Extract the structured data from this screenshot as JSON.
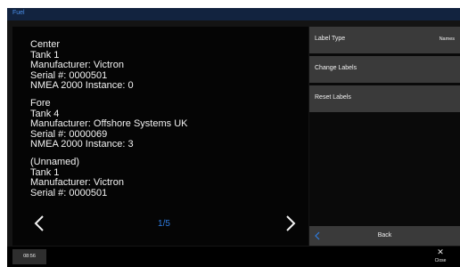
{
  "window": {
    "title": "Fuel"
  },
  "tanks": [
    {
      "name": "Center",
      "tank": "Tank 1",
      "manufacturer": "Manufacturer: Victron",
      "serial": "Serial #: 0000501",
      "instance": "NMEA 2000 Instance: 0"
    },
    {
      "name": "Fore",
      "tank": "Tank 4",
      "manufacturer": "Manufacturer: Offshore Systems UK",
      "serial": "Serial #: 0000069",
      "instance": "NMEA 2000 Instance: 3"
    },
    {
      "name": "(Unnamed)",
      "tank": "Tank 1",
      "manufacturer": "Manufacturer: Victron",
      "serial": "Serial #: 0000501"
    }
  ],
  "pager": {
    "indicator": "1/5",
    "prev_icon": "chevron-left-icon",
    "next_icon": "chevron-right-icon"
  },
  "menu": {
    "label_type": {
      "label": "Label Type",
      "value": "Names"
    },
    "change_labels": {
      "label": "Change Labels"
    },
    "reset_labels": {
      "label": "Reset Labels"
    },
    "back": {
      "label": "Back",
      "icon": "chevron-left-icon"
    }
  },
  "statusbar": {
    "time": "08:56",
    "close_label": "Close",
    "close_icon": "close-icon"
  },
  "colors": {
    "accent": "#2e7ce0",
    "title_bg": "#12233f",
    "button_bg": "#3a3a3a"
  }
}
